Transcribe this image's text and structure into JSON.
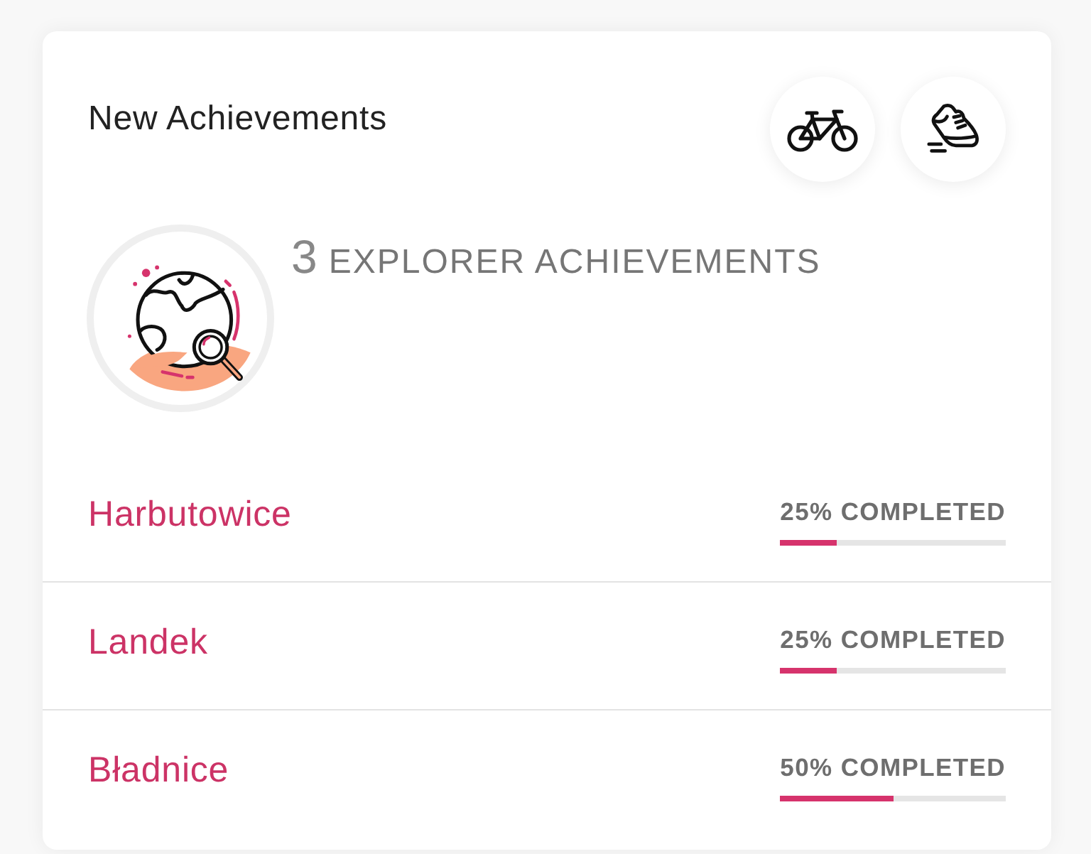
{
  "card": {
    "title": "New Achievements"
  },
  "badge": {
    "count": "3",
    "label": "EXPLORER ACHIEVEMENTS"
  },
  "rows": [
    {
      "name": "Harbutowice",
      "progress": "25% COMPLETED",
      "level": 0.25
    },
    {
      "name": "Landek",
      "progress": "25% COMPLETED",
      "level": 0.25
    },
    {
      "name": "Bładnice",
      "progress": "50% COMPLETED",
      "level": 0.5
    }
  ]
}
